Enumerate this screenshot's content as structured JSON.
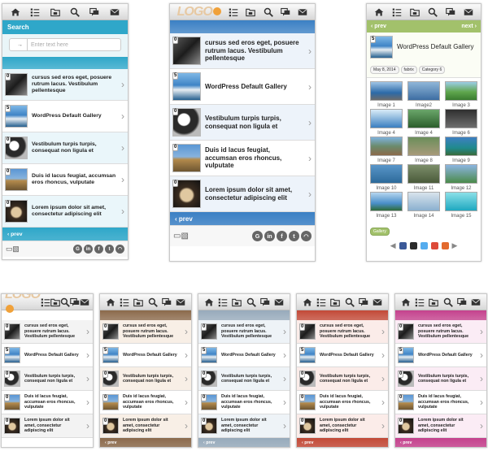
{
  "colors": {
    "cyan": "#2fa7c9",
    "blue": "#3b80c4",
    "green": "#a2c16b",
    "black": "#333",
    "brown": "#8b6a4c",
    "steel": "#97aabb",
    "red": "#c24a38",
    "pink": "#c4428d"
  },
  "top_icons": [
    "home-icon",
    "list-icon",
    "folder-icon",
    "search-icon",
    "chat-icon",
    "mail-icon"
  ],
  "logo": "LOGO",
  "search": {
    "title": "Search",
    "placeholder": "Enter text here",
    "button": "→"
  },
  "posts": [
    {
      "count": "0",
      "title": "cursus sed eros eget, posuere rutrum lacus. Vestibulum pellentesque",
      "img": "bike"
    },
    {
      "count": "5",
      "title": "WordPress Default Gallery",
      "img": "sea"
    },
    {
      "count": "0",
      "title": "Vestibulum turpis turpis, consequat non ligula et",
      "img": "people"
    },
    {
      "count": "0",
      "title": "Duis id lacus feugiat, accumsan eros rhoncus, vulputate",
      "img": "temple"
    },
    {
      "count": "0",
      "title": "Lorem ipsum dolor sit amet, consectetur adipiscing elit",
      "img": "fingers"
    }
  ],
  "nav": {
    "prev": "‹ prev",
    "next": "next ›"
  },
  "social": [
    "G",
    "in",
    "f",
    "t",
    "rss"
  ],
  "gallery": {
    "title": "WordPress Default Gallery",
    "tags": [
      "May 8, 2014",
      "fabrix",
      "Category 6"
    ],
    "category_tag": "Gallery",
    "images": [
      "Image 1",
      "Image2",
      "Image 3",
      "Image 4",
      "Image 4",
      "Image 6",
      "Image 7",
      "Image 8",
      "Image 9",
      "Image 10",
      "Image 11",
      "Image 12",
      "Image 13",
      "Image 14",
      "Image 15"
    ]
  }
}
